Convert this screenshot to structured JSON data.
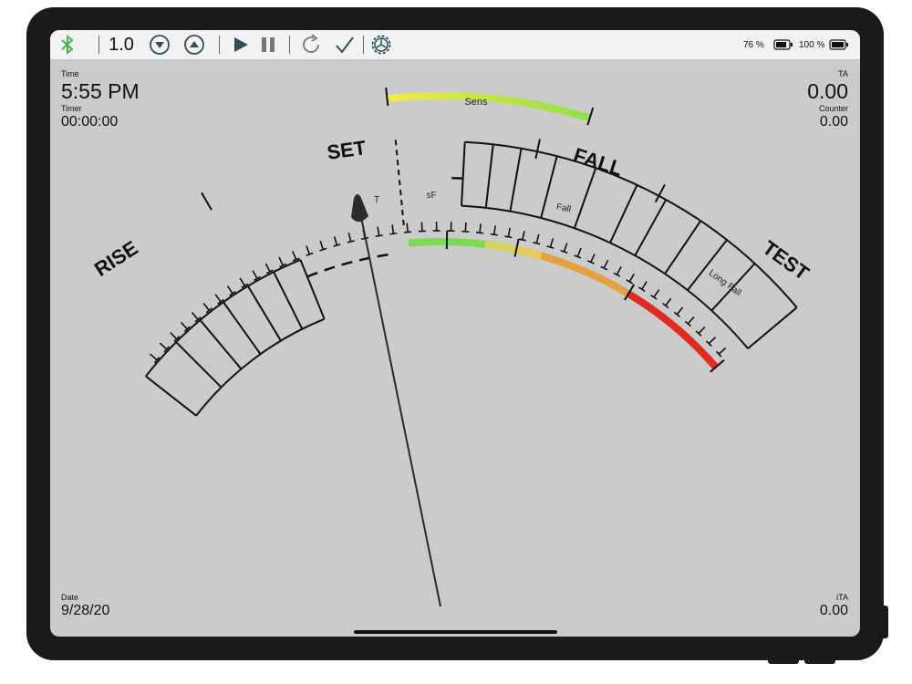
{
  "toolbar": {
    "step_value": "1.0",
    "icons": [
      "bluetooth-icon",
      "step-down-icon",
      "step-up-icon",
      "play-icon",
      "pause-icon",
      "reset-icon",
      "checkmark-icon",
      "settings-gear-icon"
    ],
    "device_battery": "76 %",
    "phone_battery": "100 %",
    "accent": "#4caf50",
    "icon_color": "#2f4f5f"
  },
  "top_left": {
    "time_label": "Time",
    "time_value": "5:55 PM",
    "timer_label": "Timer",
    "timer_value": "00:00:00"
  },
  "top_right": {
    "ta_label": "TA",
    "ta_value": "0.00",
    "counter_label": "Counter",
    "counter_value": "0.00"
  },
  "bottom_left": {
    "date_label": "Date",
    "date_value": "9/28/20"
  },
  "bottom_right": {
    "ita_label": "iTA",
    "ita_value": "0.00"
  },
  "dial": {
    "labels": {
      "rise": "RISE",
      "set": "SET",
      "fall": "FALL",
      "test": "TEST"
    },
    "top_band": {
      "label": "Sens",
      "colors": [
        "#f5ea4a",
        "#8ee04a"
      ]
    },
    "bottom_band": {
      "segments": [
        "T",
        "sF",
        "Fall",
        "Long Fall"
      ],
      "colors": [
        "#7ed957",
        "#e8d25a",
        "#e6a040",
        "#e02b20"
      ]
    }
  }
}
